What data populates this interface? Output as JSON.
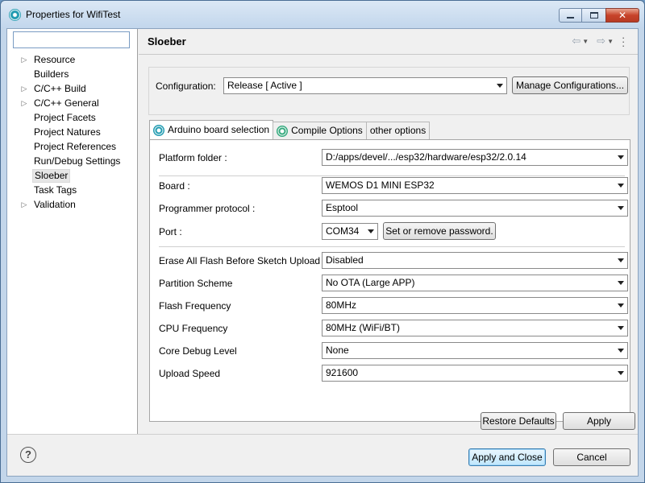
{
  "window": {
    "title": "Properties for WifiTest"
  },
  "sidebar": {
    "filter_placeholder": "",
    "items": [
      {
        "label": "Resource",
        "expandable": true
      },
      {
        "label": "Builders",
        "expandable": false
      },
      {
        "label": "C/C++ Build",
        "expandable": true
      },
      {
        "label": "C/C++ General",
        "expandable": true
      },
      {
        "label": "Project Facets",
        "expandable": false
      },
      {
        "label": "Project Natures",
        "expandable": false
      },
      {
        "label": "Project References",
        "expandable": false
      },
      {
        "label": "Run/Debug Settings",
        "expandable": false
      },
      {
        "label": "Sloeber",
        "expandable": false,
        "selected": true
      },
      {
        "label": "Task Tags",
        "expandable": false
      },
      {
        "label": "Validation",
        "expandable": true
      }
    ]
  },
  "page": {
    "title": "Sloeber",
    "configuration_label": "Configuration:",
    "configuration_value": "Release  [ Active ]",
    "manage_button": "Manage Configurations..."
  },
  "tabs": [
    {
      "label": "Arduino board selection",
      "active": true,
      "icon": "sloeber-icon"
    },
    {
      "label": "Compile Options",
      "active": false,
      "icon": "gear-icon"
    },
    {
      "label": "other options",
      "active": false,
      "icon": ""
    }
  ],
  "board": {
    "platform_label": "Platform folder :",
    "platform_value": "D:/apps/devel/.../esp32/hardware/esp32/2.0.14",
    "board_label": "Board :",
    "board_value": "WEMOS D1 MINI ESP32",
    "programmer_label": "Programmer protocol :",
    "programmer_value": "Esptool",
    "port_label": "Port :",
    "port_value": "COM34",
    "password_button": "Set or remove password.",
    "options": [
      {
        "label": "Erase All Flash Before Sketch Upload",
        "value": "Disabled"
      },
      {
        "label": "Partition Scheme",
        "value": "No OTA (Large APP)"
      },
      {
        "label": "Flash Frequency",
        "value": "80MHz"
      },
      {
        "label": "CPU Frequency",
        "value": "80MHz (WiFi/BT)"
      },
      {
        "label": "Core Debug Level",
        "value": "None"
      },
      {
        "label": "Upload Speed",
        "value": "921600"
      }
    ]
  },
  "buttons": {
    "restore_defaults": "Restore Defaults",
    "apply": "Apply",
    "apply_and_close": "Apply and Close",
    "cancel": "Cancel",
    "help": "?"
  }
}
